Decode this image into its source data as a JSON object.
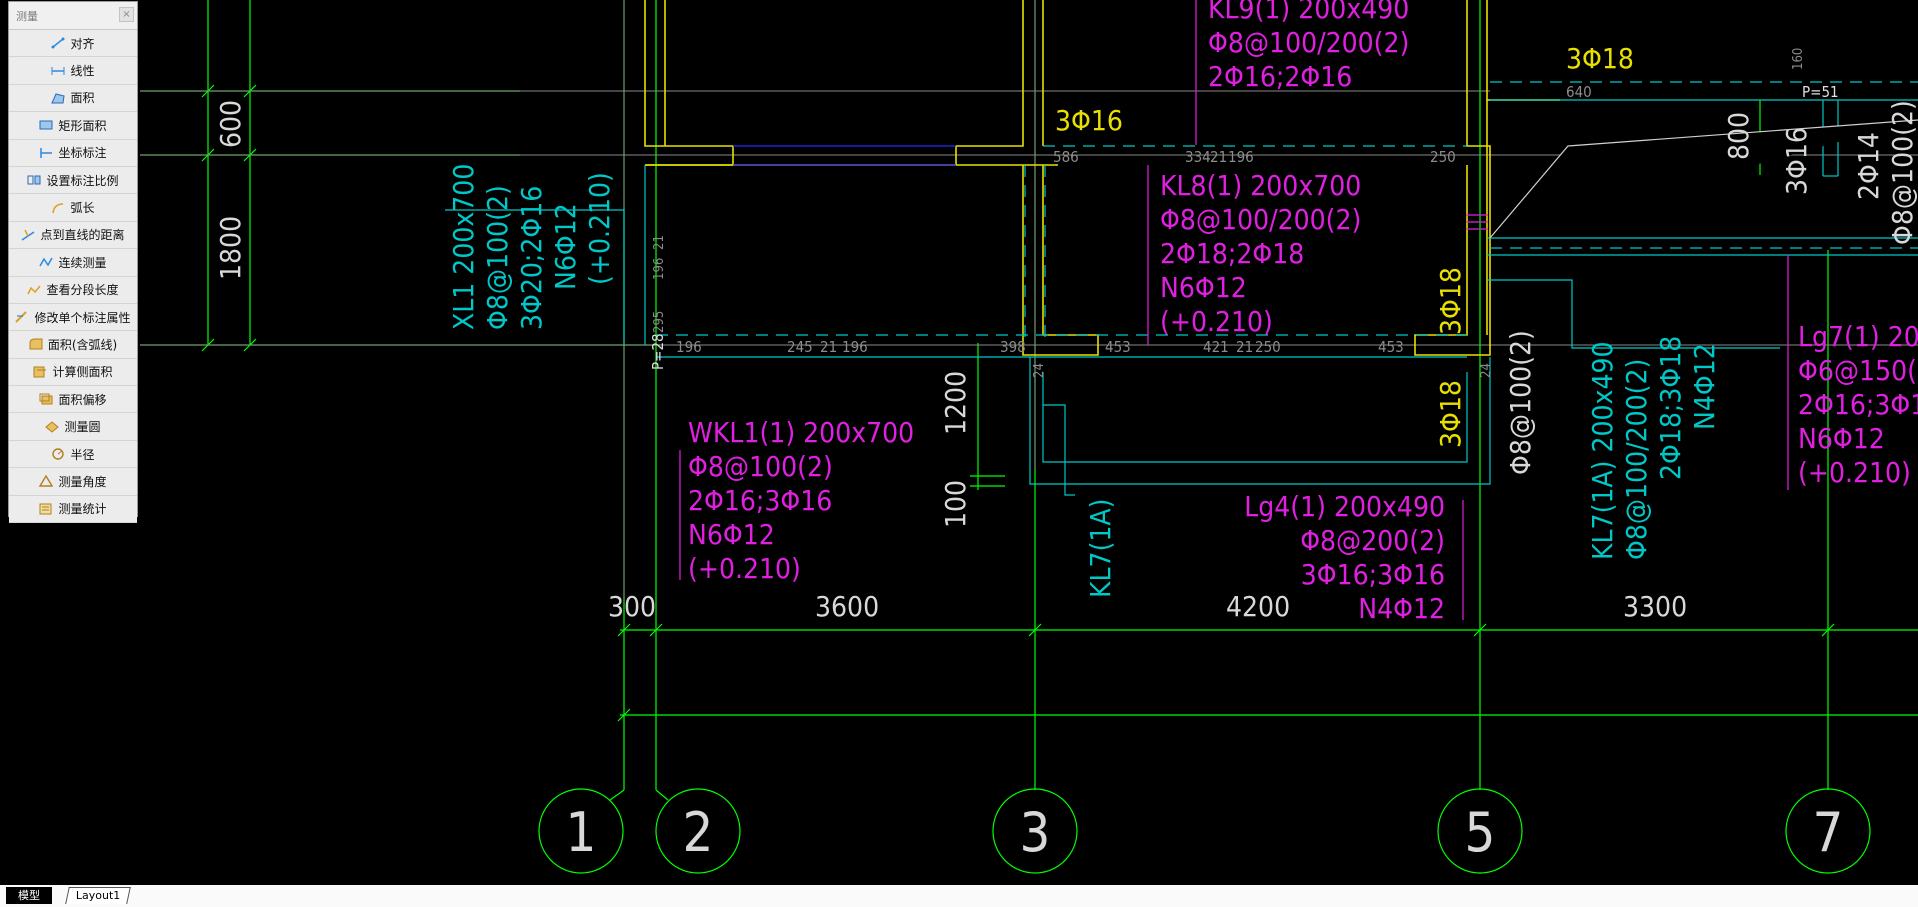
{
  "panel": {
    "title": "测量",
    "close": "×",
    "items": [
      {
        "label": "对齐",
        "icon": "aligned-dimension-icon"
      },
      {
        "label": "线性",
        "icon": "linear-dimension-icon"
      },
      {
        "label": "面积",
        "icon": "area-icon"
      },
      {
        "label": "矩形面积",
        "icon": "rect-area-icon"
      },
      {
        "label": "坐标标注",
        "icon": "coordinate-icon"
      },
      {
        "label": "设置标注比例",
        "icon": "scale-icon"
      },
      {
        "label": "弧长",
        "icon": "arc-length-icon"
      },
      {
        "label": "点到直线的距离",
        "icon": "point-line-distance-icon"
      },
      {
        "label": "连续测量",
        "icon": "continuous-measure-icon"
      },
      {
        "label": "查看分段长度",
        "icon": "segment-length-icon"
      },
      {
        "label": "修改单个标注属性",
        "icon": "edit-dimension-icon"
      },
      {
        "label": "面积(含弧线)",
        "icon": "arc-area-icon"
      },
      {
        "label": "计算侧面积",
        "icon": "side-area-icon"
      },
      {
        "label": "面积偏移",
        "icon": "area-offset-icon"
      },
      {
        "label": "测量圆",
        "icon": "circle-measure-icon"
      },
      {
        "label": "半径",
        "icon": "radius-icon"
      },
      {
        "label": "测量角度",
        "icon": "angle-icon"
      },
      {
        "label": "测量统计",
        "icon": "statistics-icon"
      }
    ]
  },
  "tabs": {
    "model": "模型",
    "layout": "Layout1"
  },
  "colors": {
    "green": "#00ff00",
    "cyan": "#00c8c8",
    "magenta": "#e020e0",
    "yellow": "#e8e000",
    "white": "#d8d8d8",
    "gray": "#909090",
    "blue": "#2828ff"
  },
  "drawing": {
    "magenta_labels": [
      "KL9(1) 200x490",
      "Φ8@100/200(2)",
      "2Φ16;2Φ16",
      "KL8(1) 200x700",
      "Φ8@100/200(2)",
      "2Φ18;2Φ18",
      "N6Φ12",
      "(+0.210)",
      "WKL1(1) 200x700",
      "Φ8@100(2)",
      "2Φ16;3Φ16",
      "N6Φ12",
      "(+0.210)",
      "Lg4(1) 200x490",
      "Φ8@200(2)",
      "3Φ16;3Φ16",
      "N4Φ12",
      "Lg7(1) 200",
      "Φ6@150(2",
      "2Φ16;3Φ16",
      "N6Φ12",
      "(+0.210)"
    ],
    "cyan_rotated": [
      {
        "lines": [
          "XL1 200x700",
          "Φ8@100(2)",
          "3Φ20;2Φ16",
          "N6Φ12",
          "(+0.210)"
        ]
      },
      {
        "lines": [
          "KL7(1A) 200x490",
          "Φ8@100/200(2)",
          "2Φ18;3Φ18",
          "N4Φ12"
        ]
      },
      {
        "lines": [
          "KL7(1A)"
        ]
      }
    ],
    "yellow_labels": [
      "3Φ16",
      "3Φ18",
      "3Φ18",
      "3Φ18"
    ],
    "white_labels": [
      "Φ8@100(2)",
      "3Φ16",
      "2Φ14",
      "Φ8@100(2)"
    ],
    "dims_vertical": [
      "600",
      "1800",
      "1200",
      "100",
      "800"
    ],
    "dims_horizontal": [
      "300",
      "3600",
      "4200",
      "3300"
    ],
    "axis_labels": [
      "1",
      "2",
      "3",
      "5",
      "7"
    ],
    "small_labels": [
      "586",
      "334",
      "21",
      "196",
      "250",
      "196",
      "245",
      "21",
      "196",
      "398",
      "453",
      "421",
      "21",
      "250",
      "453",
      "640",
      "P=51",
      "P=28",
      "295",
      "196",
      "21",
      "24",
      "24",
      "160"
    ]
  }
}
